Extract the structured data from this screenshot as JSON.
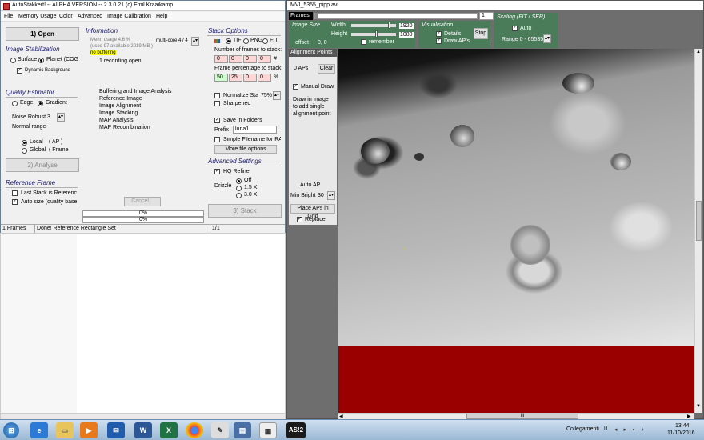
{
  "left_window": {
    "title": "AutoStakkert! -- ALPHA VERSION -- 2.3.0.21  (c) Emil Kraaikamp",
    "menu": [
      "File",
      "Memory Usage",
      "Color",
      "Advanced",
      "Image Calibration",
      "Help"
    ],
    "open_button": "1) Open",
    "image_stabilization": {
      "header": "Image Stabilization",
      "surface_label": "Surface",
      "planet_label": "Planet (COG",
      "dynamic_background_label": "Dynamic Background"
    },
    "quality_estimator": {
      "header": "Quality Estimator",
      "edge_label": "Edge",
      "gradient_label": "Gradient",
      "noise_robust_label": "Noise Robust",
      "noise_robust_value": "3",
      "normal_range_label": "Normal range",
      "local_label": "Local",
      "local_ap": "( AP )",
      "global_label": "Global",
      "global_frame": "( Frame"
    },
    "analyse_button": "2) Analyse",
    "reference_frame": {
      "header": "Reference Frame",
      "last_stack_label": "Last Stack is Reference",
      "auto_size_label": "Auto size (quality based)"
    },
    "information": {
      "header": "Information",
      "mem_line1": "Mem. usage 4.6 %",
      "mem_line2": "(used 97 available 2019 MB )",
      "buffering": "no buffering",
      "multicore_label": "multi-core",
      "multicore_value": "4 / 4",
      "recording_open": "1 recording open",
      "steps": [
        "Buffering and Image Analysis",
        "Reference Image",
        "Image Alignment",
        "Image Stacking",
        "MAP Analysis",
        "MAP Recombination"
      ],
      "cancel_button": "Cancel...",
      "progress1": "0%",
      "progress2": "0%"
    },
    "stack_options": {
      "header": "Stack Options",
      "tif_label": "TIF",
      "png_label": "PNG",
      "fit_label": "FIT",
      "frames_to_stack_label": "Number of frames to stack:",
      "frames_to_stack_values": [
        "0",
        "0",
        "0",
        "0",
        "0"
      ],
      "frames_unit": "#",
      "percentage_label": "Frame percentage to stack:",
      "percentage_values": [
        "50",
        "25",
        "0",
        "0",
        "0"
      ],
      "percentage_unit": "%",
      "normalize_label": "Normalize Stack",
      "normalize_value": "75%",
      "sharpened_label": "Sharpened",
      "save_in_folders_label": "Save in Folders",
      "prefix_label": "Prefix",
      "prefix_value": "luna1",
      "simple_filename_label": "Simple Filename for RAW",
      "more_file_options_button": "More file options"
    },
    "advanced_settings": {
      "header": "Advanced Settings",
      "hq_refine_label": "HQ Refine",
      "drizzle_label": "Drizzle",
      "drizzle_off": "Off",
      "drizzle_15": "1.5 X",
      "drizzle_30": "3.0 X"
    },
    "stack_button": "3) Stack",
    "status": {
      "frames": "1 Frames",
      "message": "Done! Reference Rectangle Set",
      "progress": "1/1"
    }
  },
  "right_window": {
    "title": "MVI_5355_pipp.avi",
    "frames_label": "Frames",
    "frame_value": "1",
    "image_size": {
      "header": "Image Size",
      "width_label": "Width",
      "width_value": "1920",
      "height_label": "Height",
      "height_value": "1080",
      "remember_label": "remember",
      "offset_label": "offset",
      "offset_value": "0, 0"
    },
    "visualisation": {
      "header": "Visualisation",
      "details_label": "Details",
      "draw_aps_label": "Draw AP's",
      "stop_button": "Stop"
    },
    "scaling": {
      "header": "Scaling (FIT / SER)",
      "auto_label": "Auto",
      "range_label": "Range 0 - 65535"
    },
    "alignment_points": {
      "header": "Alignment Points",
      "count": "0 APs",
      "clear_button": "Clear",
      "manual_draw_label": "Manual Draw",
      "instructions": [
        "Draw in image",
        "to add single",
        "alignment point"
      ],
      "auto_ap_label": "Auto AP",
      "min_bright_label": "Min Bright",
      "min_bright_value": "30",
      "place_aps_button": "Place APs in Grid",
      "replace_label": "Replace"
    },
    "scroll_marker": "III"
  },
  "taskbar": {
    "collegamenti": "Collegamenti",
    "language": "IT",
    "time": "13:44",
    "date": "11/10/2016",
    "as_label": "AS!2"
  }
}
